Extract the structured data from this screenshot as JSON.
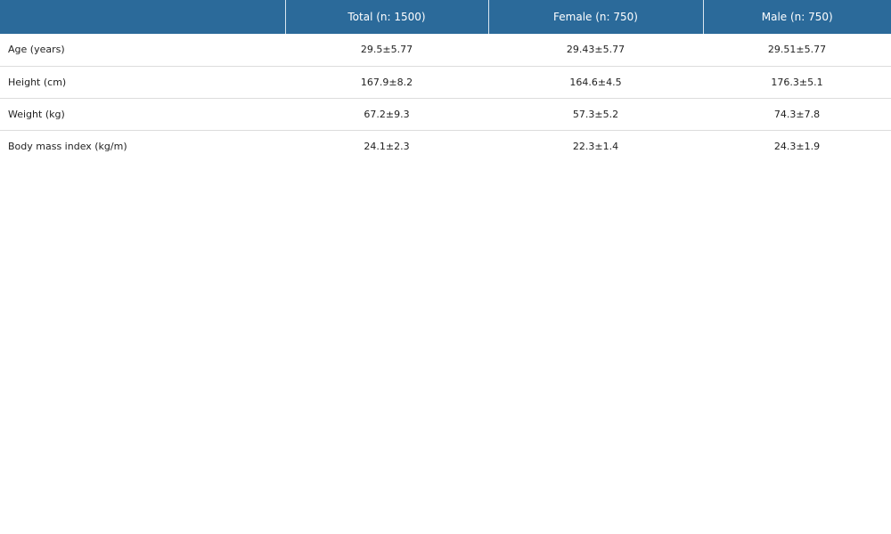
{
  "table": {
    "headers": [
      "",
      "Total (n: 1500)",
      "Female (n: 750)",
      "Male (n: 750)"
    ],
    "rows": [
      {
        "label": "Age (years)",
        "total": "29.5±5.77",
        "female": "29.43±5.77",
        "male": "29.51±5.77"
      },
      {
        "label": "Height (cm)",
        "total": "167.9±8.2",
        "female": "164.6±4.5",
        "male": "176.3±5.1"
      },
      {
        "label": "Weight (kg)",
        "total": "67.2±9.3",
        "female": "57.3±5.2",
        "male": "74.3±7.8"
      },
      {
        "label": "Body mass index (kg/m)",
        "total": "24.1±2.3",
        "female": "22.3±1.4",
        "male": "24.3±1.9"
      }
    ]
  },
  "colors": {
    "header_bg": "#2b6a9a",
    "header_text": "#ffffff",
    "row_divider": "#dcdcdc"
  }
}
